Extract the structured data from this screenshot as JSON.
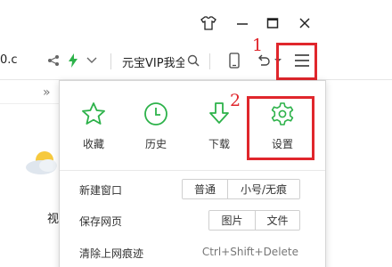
{
  "toolbar": {
    "url_fragment": "0.c",
    "search_text": "元宝VIP我全"
  },
  "annotations": {
    "step1": "1",
    "step2": "2"
  },
  "menu": {
    "top_items": [
      {
        "label": "收藏",
        "icon": "star-icon"
      },
      {
        "label": "历史",
        "icon": "clock-icon"
      },
      {
        "label": "下载",
        "icon": "download-icon"
      },
      {
        "label": "设置",
        "icon": "gear-icon"
      }
    ],
    "new_window": {
      "label": "新建窗口",
      "normal": "普通",
      "incognito": "小号/无痕"
    },
    "save_page": {
      "label": "保存网页",
      "image": "图片",
      "file": "文件"
    },
    "clear_history": {
      "label": "清除上网痕迹",
      "shortcut": "Ctrl+Shift+Delete"
    }
  },
  "left_page": {
    "text_fragment": "视"
  },
  "colors": {
    "accent_green": "#2db24a",
    "annotation_red": "#e0262c"
  }
}
